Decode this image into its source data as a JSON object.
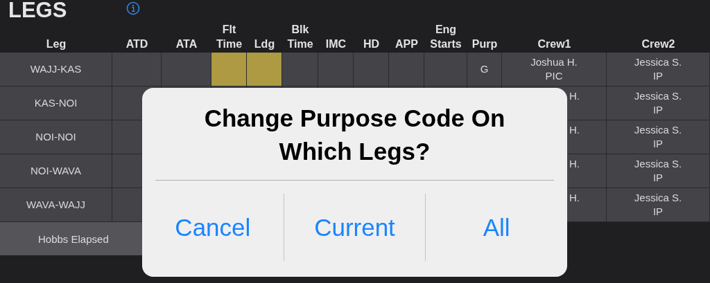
{
  "title": "LEGS",
  "table": {
    "columns": [
      "Leg",
      "ATD",
      "ATA",
      "Flt Time",
      "Ldg",
      "Blk Time",
      "IMC",
      "HD",
      "APP",
      "Eng Starts",
      "Purp",
      "Crew1",
      "Crew2"
    ],
    "rows": [
      {
        "leg": "WAJJ-KAS",
        "flt_time_highlighted": true,
        "ldg_highlighted": true,
        "purp": "G",
        "crew1": [
          "Joshua H.",
          "PIC"
        ],
        "crew2": [
          "Jessica S.",
          "IP"
        ]
      },
      {
        "leg": "KAS-NOI",
        "crew1": [
          "H."
        ],
        "crew2": [
          "Jessica S.",
          "IP"
        ]
      },
      {
        "leg": "NOI-NOI",
        "crew1": [
          "H."
        ],
        "crew2": [
          "Jessica S.",
          "IP"
        ]
      },
      {
        "leg": "NOI-WAVA",
        "crew1": [
          "H."
        ],
        "crew2": [
          "Jessica S.",
          "IP"
        ]
      },
      {
        "leg": "WAVA-WAJJ",
        "crew1": [
          "H."
        ],
        "crew2": [
          "Jessica S.",
          "IP"
        ]
      }
    ],
    "footer": "Hobbs Elapsed"
  },
  "dialog": {
    "title": "Change Purpose Code On Which Legs?",
    "buttons": [
      "Cancel",
      "Current",
      "All"
    ]
  }
}
